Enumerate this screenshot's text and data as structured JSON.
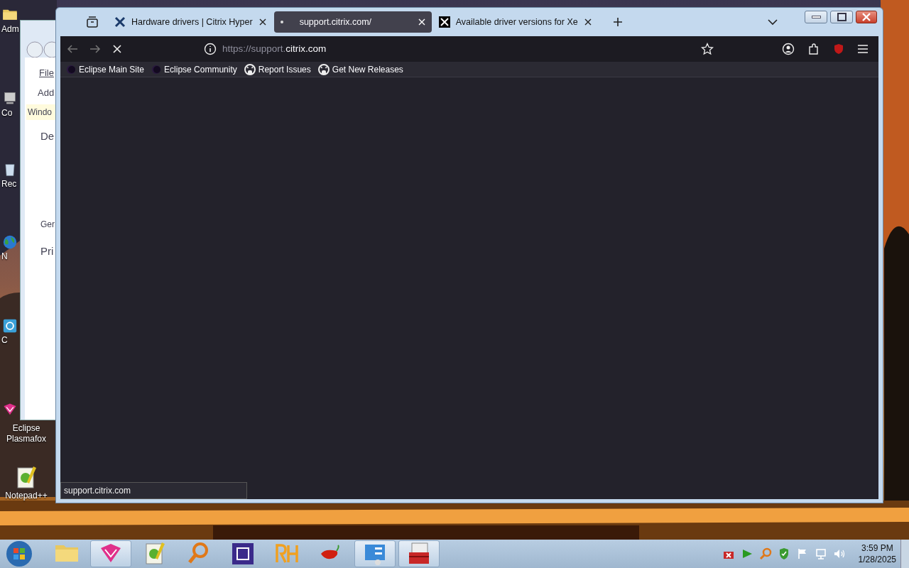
{
  "desktop": {
    "icons": [
      {
        "label": "Adm",
        "kind": "folder"
      },
      {
        "label": "Co",
        "kind": "computer"
      },
      {
        "label": "Rec",
        "kind": "bin"
      },
      {
        "label": "N",
        "kind": "globe"
      },
      {
        "label": "C",
        "kind": "app"
      },
      {
        "label": "Eclipse Plasmafox",
        "kind": "plasmafox"
      },
      {
        "label": "Notepad++",
        "kind": "notepad"
      }
    ]
  },
  "back_window": {
    "menu": "File",
    "toolbar": "Add",
    "banner": "Windo",
    "groups": [
      {
        "label": "De"
      },
      {
        "label": "Pri"
      }
    ],
    "item": "Ger"
  },
  "browser": {
    "tabs": [
      {
        "title": "Hardware drivers | Citrix Hyper",
        "selected": false,
        "loading": false
      },
      {
        "title": "support.citrix.com/",
        "selected": true,
        "loading": true
      },
      {
        "title": "Available driver versions for Xe",
        "selected": false,
        "loading": false
      }
    ],
    "address": {
      "prefix": "https://support.",
      "host": "citrix.com"
    },
    "bookmarks": [
      {
        "label": "Eclipse Main Site",
        "kind": "eclipse"
      },
      {
        "label": "Eclipse Community",
        "kind": "eclipse"
      },
      {
        "label": "Report Issues",
        "kind": "github"
      },
      {
        "label": "Get New Releases",
        "kind": "github"
      }
    ],
    "status": "support.citrix.com"
  },
  "taskbar": {
    "apps": [
      {
        "kind": "folder",
        "running": false
      },
      {
        "kind": "plasmafox",
        "running": true
      },
      {
        "kind": "notepad",
        "running": false
      },
      {
        "kind": "search",
        "running": false
      },
      {
        "kind": "chip",
        "running": false
      },
      {
        "kind": "rh",
        "running": false
      },
      {
        "kind": "pepper",
        "running": false
      },
      {
        "kind": "panel",
        "running": true
      },
      {
        "kind": "toolbox",
        "running": true
      }
    ],
    "clock": {
      "time": "3:59 PM",
      "date": "1/28/2025"
    }
  }
}
